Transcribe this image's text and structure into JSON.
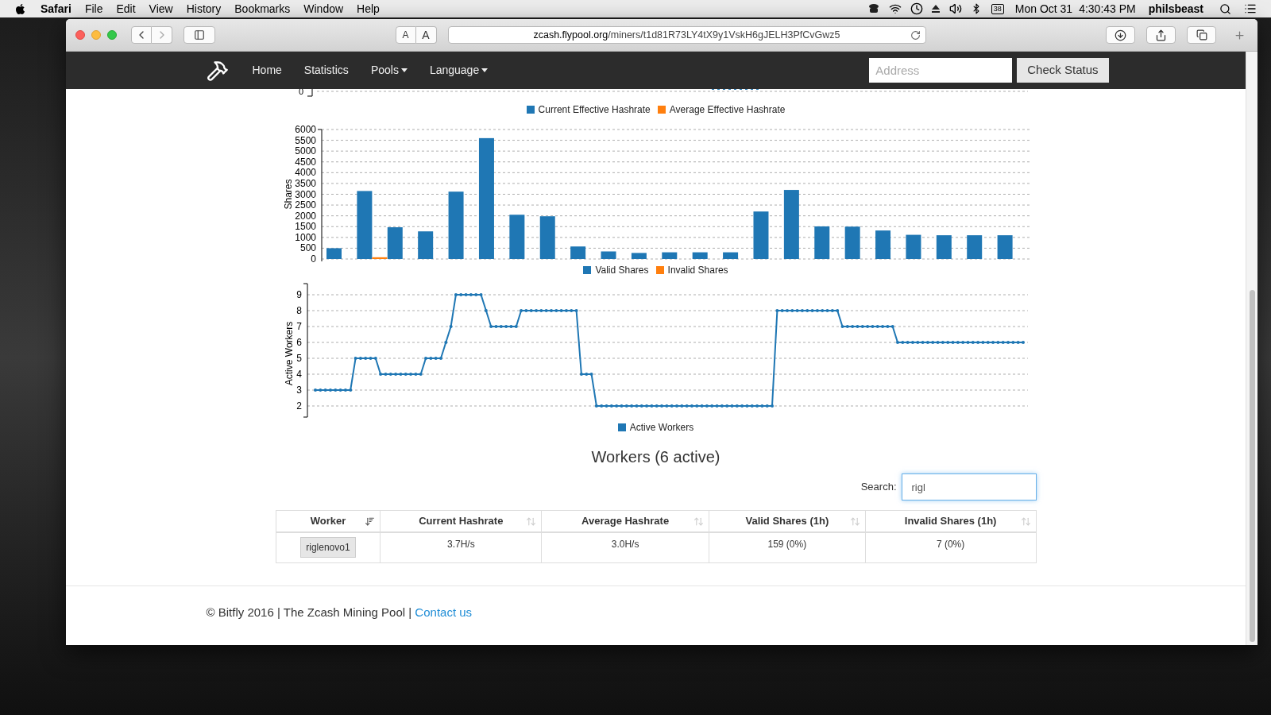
{
  "menu_bar": {
    "app": "Safari",
    "menus": [
      "File",
      "Edit",
      "View",
      "History",
      "Bookmarks",
      "Window",
      "Help"
    ],
    "temperature": "38",
    "date": "Mon Oct 31",
    "time": "4:30:43 PM",
    "user": "philsbeast"
  },
  "browser": {
    "text_size_buttons": [
      "A",
      "A"
    ],
    "url_domain": "zcash.flypool.org",
    "url_path": "/miners/t1d81R73LY4tX9y1VskH6gJELH3PfCvGwz5"
  },
  "navbar": {
    "links": [
      {
        "label": "Home",
        "dropdown": false
      },
      {
        "label": "Statistics",
        "dropdown": false
      },
      {
        "label": "Pools",
        "dropdown": true
      },
      {
        "label": "Language",
        "dropdown": true
      }
    ],
    "address_placeholder": "Address",
    "check_button": "Check Status"
  },
  "hashrate_chart": {
    "y_tick": "0",
    "legend": [
      {
        "label": "Current Effective Hashrate",
        "color": "#1f77b4"
      },
      {
        "label": "Average Effective Hashrate",
        "color": "#ff7f0e"
      }
    ]
  },
  "shares_chart": {
    "chart_data": {
      "type": "bar",
      "grid": true,
      "ylabel": "Shares",
      "ylim": [
        0,
        6000
      ],
      "yticks": [
        0,
        500,
        1000,
        1500,
        2000,
        2500,
        3000,
        3500,
        4000,
        4500,
        5000,
        5500,
        6000
      ],
      "series": [
        {
          "name": "Valid Shares",
          "color": "#1f77b4",
          "values": [
            500,
            3150,
            1470,
            1280,
            3120,
            5600,
            2050,
            1980,
            580,
            350,
            280,
            310,
            310,
            310,
            2200,
            3200,
            1510,
            1500,
            1320,
            1120,
            1100,
            1100,
            1100
          ]
        },
        {
          "name": "Invalid Shares",
          "color": "#ff7f0e",
          "values": [
            0,
            80,
            0,
            0,
            0,
            0,
            0,
            0,
            0,
            0,
            0,
            0,
            0,
            0,
            0,
            0,
            0,
            0,
            0,
            0,
            0,
            0,
            0
          ]
        }
      ]
    }
  },
  "workers_chart": {
    "chart_data": {
      "type": "line",
      "grid": true,
      "ylabel": "Active Workers",
      "ylim": [
        1.3,
        9.7
      ],
      "yticks": [
        2,
        3,
        4,
        5,
        6,
        7,
        8,
        9
      ],
      "series": [
        {
          "name": "Active Workers",
          "color": "#1f77b4",
          "values": [
            3,
            3,
            3,
            3,
            3,
            3,
            3,
            3,
            5,
            5,
            5,
            5,
            5,
            4,
            4,
            4,
            4,
            4,
            4,
            4,
            4,
            4,
            5,
            5,
            5,
            5,
            6,
            7,
            9,
            9,
            9,
            9,
            9,
            9,
            8,
            7,
            7,
            7,
            7,
            7,
            7,
            8,
            8,
            8,
            8,
            8,
            8,
            8,
            8,
            8,
            8,
            8,
            8,
            4,
            4,
            4,
            2,
            2,
            2,
            2,
            2,
            2,
            2,
            2,
            2,
            2,
            2,
            2,
            2,
            2,
            2,
            2,
            2,
            2,
            2,
            2,
            2,
            2,
            2,
            2,
            2,
            2,
            2,
            2,
            2,
            2,
            2,
            2,
            2,
            2,
            2,
            2,
            8,
            8,
            8,
            8,
            8,
            8,
            8,
            8,
            8,
            8,
            8,
            8,
            8,
            7,
            7,
            7,
            7,
            7,
            7,
            7,
            7,
            7,
            7,
            7,
            6,
            6,
            6,
            6,
            6,
            6,
            6,
            6,
            6,
            6,
            6,
            6,
            6,
            6,
            6,
            6,
            6,
            6,
            6,
            6,
            6,
            6,
            6,
            6,
            6,
            6
          ]
        }
      ]
    }
  },
  "workers": {
    "title": "Workers (6 active)",
    "search_label": "Search:",
    "search_value": "rigl",
    "columns": [
      {
        "label": "Worker",
        "sorted": true
      },
      {
        "label": "Current Hashrate",
        "sorted": false
      },
      {
        "label": "Average Hashrate",
        "sorted": false
      },
      {
        "label": "Valid Shares (1h)",
        "sorted": false
      },
      {
        "label": "Invalid Shares (1h)",
        "sorted": false
      }
    ],
    "rows": [
      {
        "cells": [
          "riglenovo1",
          "3.7H/s",
          "3.0H/s",
          "159 (0%)",
          "7 (0%)"
        ]
      }
    ]
  },
  "footer": {
    "text": "© Bitfly 2016 | The Zcash Mining Pool | ",
    "link": "Contact us"
  }
}
